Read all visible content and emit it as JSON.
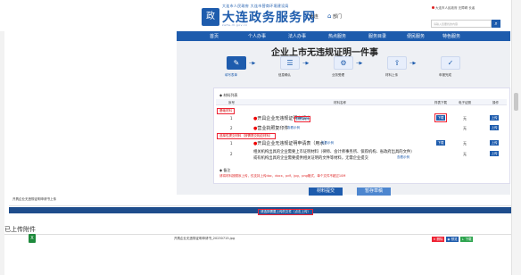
{
  "header": {
    "logo_top": "大连市人民政府 大连市营商环境建设局",
    "logo_name": "大连政务服务网",
    "logo_url": "zwfw.dl.gov.cn",
    "location": "大连",
    "department": "部门",
    "gov_links": "大连市人民政府  无障碍  长者",
    "search_placeholder": "请输入您要找的内容"
  },
  "nav": [
    "首页",
    "个人办事",
    "法人办事",
    "热点服务",
    "服务目录",
    "便民服务",
    "特色服务"
  ],
  "page_title": "企业上市无违规证明一件事",
  "steps": [
    {
      "label": "填写表单",
      "active": true
    },
    {
      "label": "信息确认",
      "active": false
    },
    {
      "label": "业务受理",
      "active": false
    },
    {
      "label": "材料上传",
      "active": false
    },
    {
      "label": "申报完成",
      "active": false
    }
  ],
  "materials": {
    "section_label": "材料列表",
    "columns": [
      "序号",
      "材料名称",
      "样表下载",
      "电子证照",
      "操作"
    ],
    "groups": [
      "基础材料",
      "选择性提交材料（按需提交相应材料）"
    ],
    "rows": [
      {
        "no": "1",
        "name": "开具企业无违规证明申请书",
        "example": "查看示例",
        "download": "下载",
        "license": "无",
        "action": "上传"
      },
      {
        "no": "2",
        "name": "营业执照复印件",
        "example": "查看示例",
        "download": "",
        "license": "无",
        "action": "上传"
      },
      {
        "no": "1",
        "name": "开具企业无违规证明申请表（用水）",
        "example": "查看示例",
        "download": "下载",
        "license": "无",
        "action": "上传"
      },
      {
        "no": "2",
        "name": "相关机构出具的企业需要上市证明材料（律师、会计师事务所、保荐机构、省政府出具的文件）",
        "name2": "或有机构出具的企业需要提供相关证明的文件等材料，无需企业提交",
        "example": "查看示例",
        "download": "",
        "license": "无",
        "action": "上传"
      }
    ],
    "note_label": "备注",
    "note_text": "请将材料按顺序上传，仅支持上传doc、docx、pdf、jpg、png格式，单个文件不超过10M"
  },
  "actions": {
    "submit": "材料提交",
    "save_draft": "暂存草稿"
  },
  "lower": {
    "title": "开具企业无违规证明申请书上传",
    "upload_link": "请选择需要上传的文件（点击上传）",
    "uploaded_title": "已上传附件",
    "file_name": "开具企业无违规证明申请书_20230715.jpg",
    "file_buttons": [
      "删除",
      "预览",
      "下载"
    ]
  },
  "colors": {
    "primary": "#1e5cad",
    "danger": "#e23",
    "excel": "#1e8a3c"
  }
}
